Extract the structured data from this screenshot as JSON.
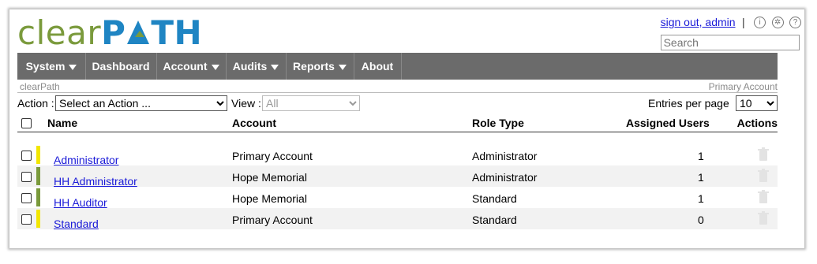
{
  "logo": {
    "light": "clear",
    "bold_p": "P",
    "bold_rest": "TH"
  },
  "header": {
    "signout": "sign out, admin",
    "separator": "|",
    "search_placeholder": "Search"
  },
  "nav": [
    {
      "label": "System",
      "dropdown": true
    },
    {
      "label": "Dashboard",
      "dropdown": false
    },
    {
      "label": "Account",
      "dropdown": true
    },
    {
      "label": "Audits",
      "dropdown": true
    },
    {
      "label": "Reports",
      "dropdown": true
    },
    {
      "label": "About",
      "dropdown": false
    }
  ],
  "subbar": {
    "left": "clearPath",
    "right": "Primary Account"
  },
  "controls": {
    "action_label": "Action :",
    "action_value": "Select an Action ...",
    "view_label": "View :",
    "view_value": "All",
    "entries_label": "Entries per page",
    "entries_value": "10"
  },
  "table": {
    "headers": {
      "name": "Name",
      "account": "Account",
      "role": "Role Type",
      "users": "Assigned Users",
      "actions": "Actions"
    },
    "rows": [
      {
        "name": "Administrator",
        "account": "Primary Account",
        "role": "Administrator",
        "users": "1",
        "bar_color": "#f2e600"
      },
      {
        "name": "HH Administrator",
        "account": "Hope Memorial",
        "role": "Administrator",
        "users": "1",
        "bar_color": "#7a9a3c"
      },
      {
        "name": "HH Auditor",
        "account": "Hope Memorial",
        "role": "Standard",
        "users": "1",
        "bar_color": "#7a9a3c"
      },
      {
        "name": "Standard",
        "account": "Primary Account",
        "role": "Standard",
        "users": "0",
        "bar_color": "#f2e600"
      }
    ]
  },
  "colors": {
    "nav_bg": "#6b6b6b",
    "logo_green": "#7a9a3c",
    "logo_blue": "#1f85c3",
    "link": "#1a1ad8"
  }
}
